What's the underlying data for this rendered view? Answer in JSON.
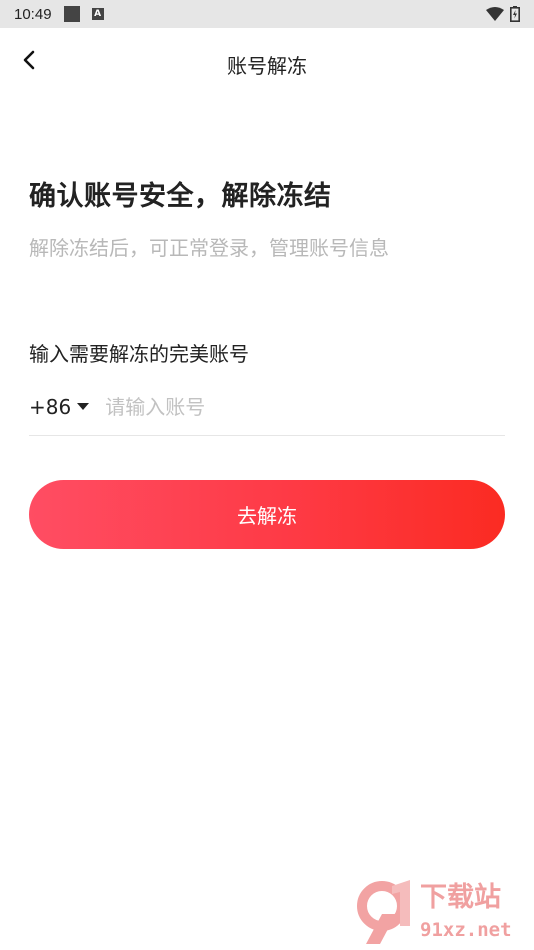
{
  "status_bar": {
    "time": "10:49",
    "notification_badge": "A"
  },
  "nav": {
    "title": "账号解冻"
  },
  "main": {
    "headline": "确认账号安全，解除冻结",
    "subtitle": "解除冻结后，可正常登录，管理账号信息",
    "input_label": "输入需要解冻的完美账号",
    "country_code": "+86",
    "account_placeholder": "请输入账号",
    "account_value": "",
    "submit_label": "去解冻"
  },
  "watermark": {
    "mark": "9",
    "line1": "下载站",
    "line2": "91xz.net"
  },
  "colors": {
    "accent_start": "#ff4d63",
    "accent_end": "#fb2b22",
    "status_bar_bg": "#e6e6e6"
  },
  "icons": [
    "back-arrow-icon",
    "caret-down-icon",
    "wifi-icon",
    "battery-icon"
  ]
}
